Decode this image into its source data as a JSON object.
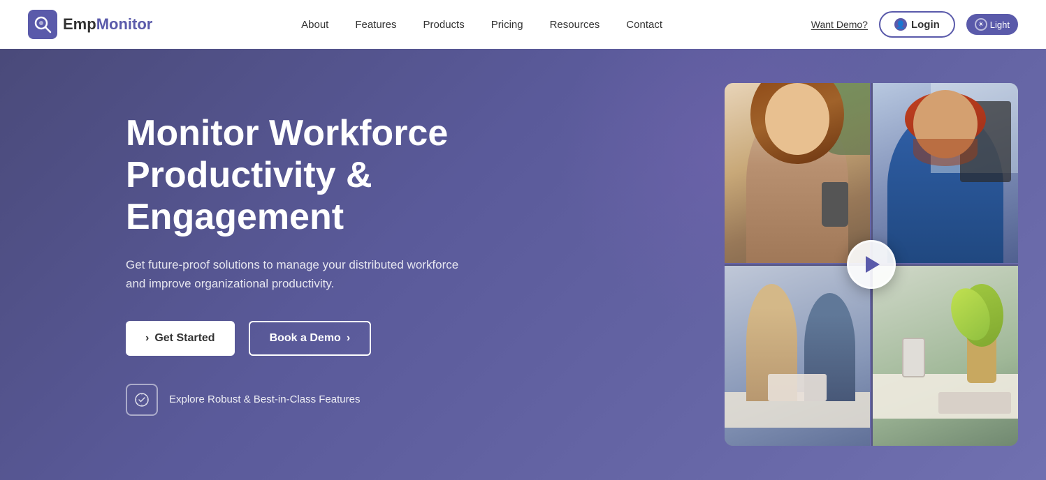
{
  "brand": {
    "name_part1": "Emp",
    "name_part2": "Monitor",
    "logo_alt": "EmpMonitor logo"
  },
  "navbar": {
    "items": [
      {
        "label": "About",
        "id": "about"
      },
      {
        "label": "Features",
        "id": "features"
      },
      {
        "label": "Products",
        "id": "products"
      },
      {
        "label": "Pricing",
        "id": "pricing"
      },
      {
        "label": "Resources",
        "id": "resources"
      },
      {
        "label": "Contact",
        "id": "contact"
      }
    ],
    "want_demo": "Want Demo?",
    "login": "Login",
    "theme_toggle": "Light"
  },
  "hero": {
    "title_line1": "Monitor  Workforce",
    "title_line2": "Productivity & Engagement",
    "subtitle": "Get future-proof solutions to manage your distributed workforce and improve organizational productivity.",
    "btn_primary": "Get Started",
    "btn_primary_arrow": "›",
    "btn_secondary": "Book a Demo",
    "btn_secondary_arrow": "›",
    "feature_text": "Explore Robust & Best-in-Class Features"
  },
  "colors": {
    "brand_purple": "#5a5aaa",
    "hero_bg_start": "#4a4a7a",
    "hero_bg_end": "#7070b0",
    "white": "#ffffff",
    "dark_text": "#333333"
  }
}
